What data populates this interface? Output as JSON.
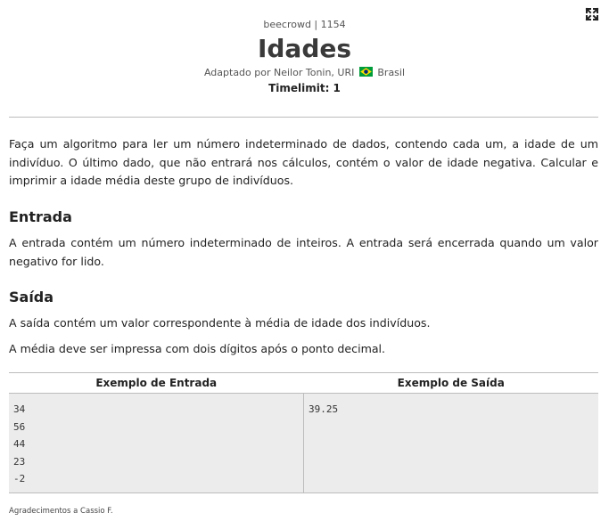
{
  "header": {
    "source": "beecrowd | 1154",
    "title": "Idades",
    "author_prefix": "Adaptado por Neilor Tonin, URI",
    "country": "Brasil",
    "timelimit": "Timelimit: 1"
  },
  "description": "Faça um algoritmo para ler um número indeterminado de dados, contendo cada um, a idade de um indivíduo. O último dado, que não entrará nos cálculos, contém o valor de idade negativa. Calcular e imprimir a idade média deste grupo de indivíduos.",
  "input_section": {
    "heading": "Entrada",
    "text": "A entrada contém um número indeterminado de inteiros. A entrada será encerrada quando um valor negativo for lido."
  },
  "output_section": {
    "heading": "Saída",
    "text1": "A saída contém um valor correspondente à média de idade dos indivíduos.",
    "text2": "A média deve ser impressa com dois dígitos após o ponto decimal."
  },
  "samples": {
    "input_header": "Exemplo de Entrada",
    "output_header": "Exemplo de Saída",
    "input_lines": [
      "34",
      "56",
      "44",
      "23",
      "-2"
    ],
    "output_lines": [
      "39.25"
    ]
  },
  "credits": "Agradecimentos a Cassio F.",
  "icons": {
    "expand": "expand-icon",
    "flag": "brazil-flag-icon"
  },
  "colors": {
    "title": "#3a3a3a",
    "sample_bg": "#ececec",
    "divider": "#bcbcbc",
    "flag_green": "#009c3b",
    "flag_yellow": "#ffdf00",
    "flag_blue": "#002776"
  }
}
